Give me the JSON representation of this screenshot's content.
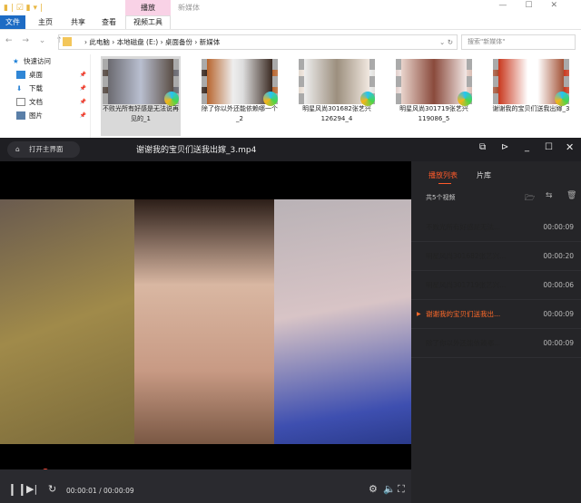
{
  "explorer": {
    "context_tab": "播放",
    "context_sub": "视频工具",
    "window_title": "新媒体",
    "tabs": [
      "文件",
      "主页",
      "共享",
      "查看"
    ],
    "breadcrumb": [
      "此电脑",
      "本地磁盘 (E:)",
      "桌面备份",
      "新媒体"
    ],
    "search_placeholder": "搜索\"新媒体\"",
    "sidebar": [
      "快速访问",
      "桌面",
      "下载",
      "文档",
      "图片"
    ],
    "files": [
      {
        "name": "不败光所有好感是无法说再见的_1"
      },
      {
        "name": "除了你以外还能依赖哪一个_2"
      },
      {
        "name": "明星风尚301682张艺兴126294_4"
      },
      {
        "name": "明星风尚301719张艺兴119086_5"
      },
      {
        "name": "谢谢我的宝贝们送我出嫁_3"
      }
    ]
  },
  "player": {
    "home_label": "打开主界面",
    "title": "谢谢我的宝贝们送我出嫁_3.mp4",
    "playlist_tab": "播放列表",
    "library_tab": "片库",
    "count": "共5个视频",
    "items": [
      {
        "name": "不败光所有好感是无法...",
        "duration": "00:00:09"
      },
      {
        "name": "明星风尚301682张艺兴...",
        "duration": "00:00:20"
      },
      {
        "name": "明星风尚301719张艺兴...",
        "duration": "00:00:06"
      },
      {
        "name": "谢谢我的宝贝们送我出...",
        "duration": "00:00:09",
        "current": true
      },
      {
        "name": "除了你以外还能依赖哪...",
        "duration": "00:00:09"
      }
    ],
    "current_time": "00:00:01",
    "separator": " / ",
    "total_time": "00:00:09",
    "progress": 0.11,
    "accent": "#ff5a2a"
  }
}
